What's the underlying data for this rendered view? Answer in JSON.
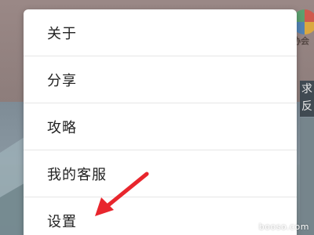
{
  "background": {
    "logo_text": "协会",
    "side_box_chars": [
      "求",
      "反"
    ]
  },
  "menu": {
    "items": [
      {
        "label": "关于"
      },
      {
        "label": "分享"
      },
      {
        "label": "攻略"
      },
      {
        "label": "我的客服"
      },
      {
        "label": "设置"
      }
    ]
  },
  "annotation": {
    "arrow_color": "#e8262d"
  },
  "watermark": "booso.com"
}
